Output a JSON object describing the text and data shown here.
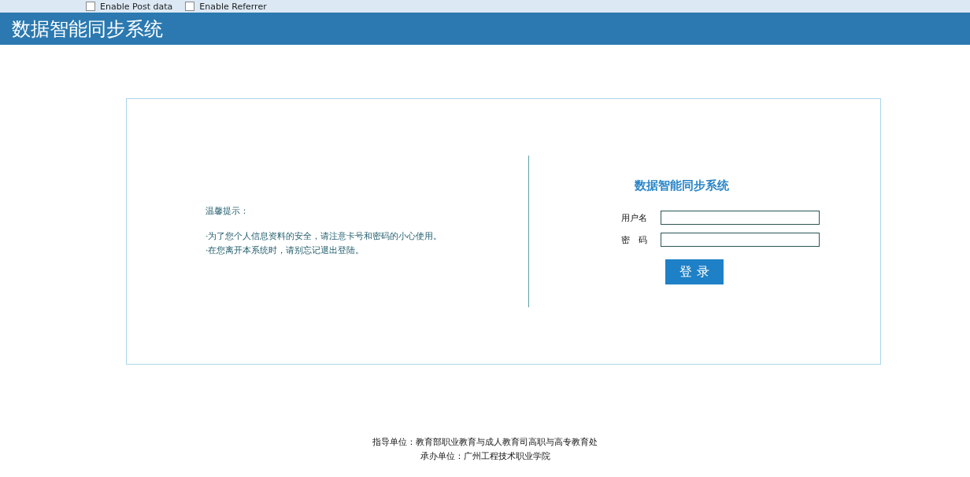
{
  "toolbar": {
    "options": [
      {
        "label": "Enable Post data",
        "checked": false
      },
      {
        "label": "Enable Referrer",
        "checked": false
      }
    ]
  },
  "header": {
    "title": "数据智能同步系统"
  },
  "notice": {
    "title": "温馨提示：",
    "lines": [
      "·为了您个人信息资料的安全，请注意卡号和密码的小心使用。",
      "·在您离开本系统时，请别忘记退出登陆。"
    ]
  },
  "login": {
    "title": "数据智能同步系统",
    "fields": [
      {
        "label": "用户名"
      },
      {
        "label": "密　码"
      }
    ],
    "button": "登 录"
  },
  "footer": {
    "lines": [
      "指导单位：教育部职业教育与成人教育司高职与高专教育处",
      "承办单位：广州工程技术职业学院"
    ]
  }
}
